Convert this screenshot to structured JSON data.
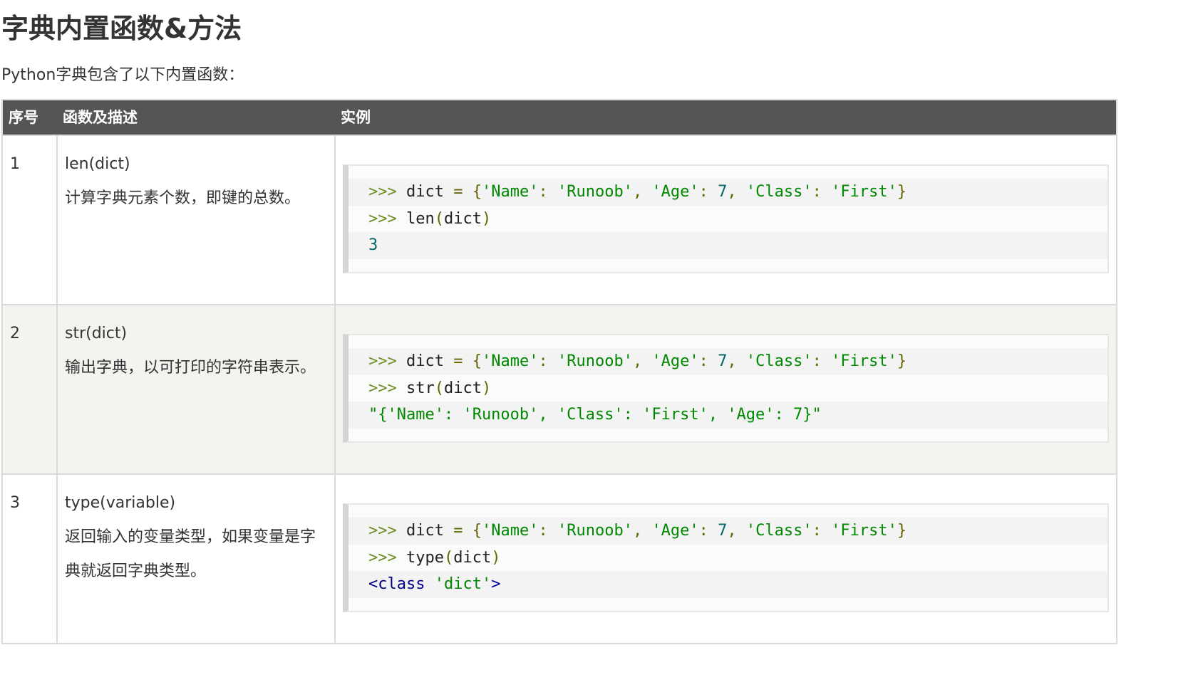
{
  "heading": "字典内置函数&方法",
  "intro": "Python字典包含了以下内置函数：",
  "table": {
    "headers": [
      "序号",
      "函数及描述",
      "实例"
    ],
    "rows": [
      {
        "num": "1",
        "func": "len(dict)",
        "desc": "计算字典元素个数，即键的总数。",
        "code": [
          ">>> dict = {'Name': 'Runoob', 'Age': 7, 'Class': 'First'}",
          ">>> len(dict)",
          "3"
        ]
      },
      {
        "num": "2",
        "func": "str(dict)",
        "desc": "输出字典，以可打印的字符串表示。",
        "code": [
          ">>> dict = {'Name': 'Runoob', 'Age': 7, 'Class': 'First'}",
          ">>> str(dict)",
          "\"{'Name': 'Runoob', 'Class': 'First', 'Age': 7}\""
        ]
      },
      {
        "num": "3",
        "func": "type(variable)",
        "desc": "返回输入的变量类型，如果变量是字典就返回字典类型。",
        "code": [
          ">>> dict = {'Name': 'Runoob', 'Age': 7, 'Class': 'First'}",
          ">>> type(dict)",
          "<class 'dict'>"
        ]
      }
    ]
  },
  "colors": {
    "header_bg": "#555555",
    "alt_row_bg": "#f4f3f0",
    "string": "#008800",
    "number": "#006666",
    "keyword": "#000088",
    "prompt": "#6b8e23"
  }
}
